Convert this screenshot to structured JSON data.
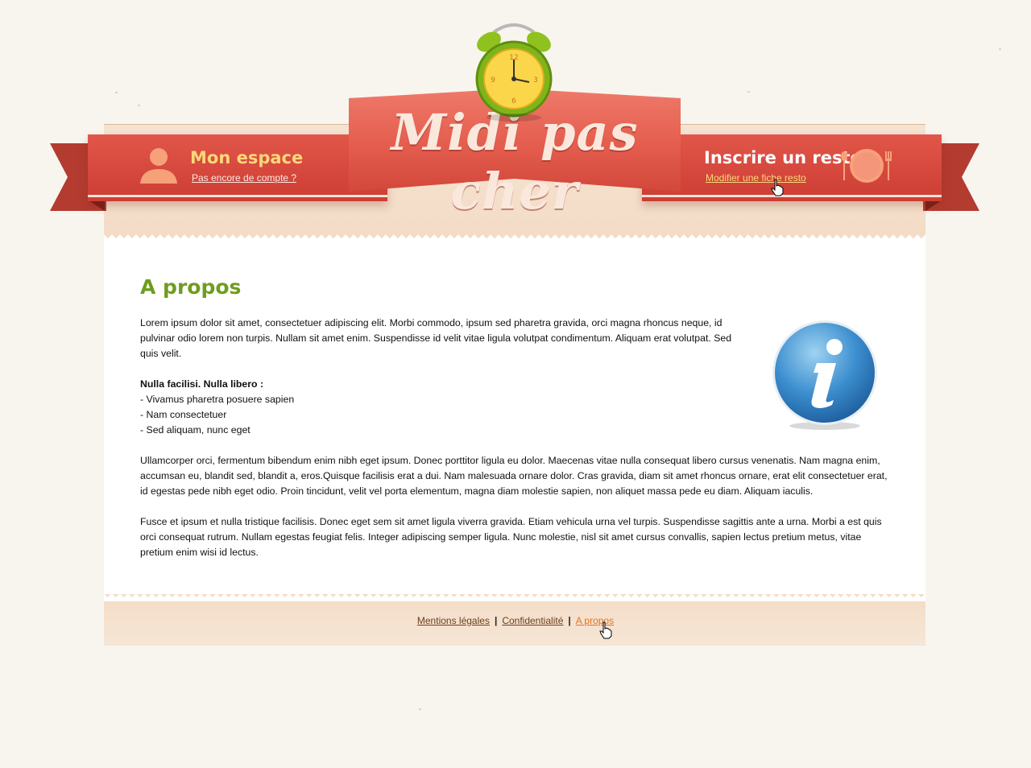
{
  "header": {
    "site_title": "Midi pas cher",
    "account": {
      "title": "Mon espace",
      "link": "Pas encore de compte ?"
    },
    "restaurant": {
      "title": "Inscrire un resto",
      "link": "Modifier une fiche resto"
    }
  },
  "main": {
    "title": "A propos",
    "intro": "Lorem ipsum dolor sit amet, consectetuer adipiscing elit. Morbi commodo, ipsum sed pharetra gravida, orci magna rhoncus neque, id pulvinar odio lorem non turpis. Nullam sit amet enim. Suspendisse id velit vitae ligula volutpat condimentum. Aliquam erat volutpat. Sed quis velit.",
    "list_title": "Nulla facilisi. Nulla libero :",
    "list_items": [
      "- Vivamus pharetra posuere sapien",
      "- Nam consectetuer",
      "- Sed aliquam, nunc eget"
    ],
    "paragraph2": "Ullamcorper orci, fermentum bibendum enim nibh eget ipsum. Donec porttitor ligula eu dolor. Maecenas vitae nulla consequat libero cursus venenatis. Nam magna enim, accumsan eu, blandit sed, blandit a, eros.Quisque facilisis erat a dui. Nam malesuada ornare dolor. Cras gravida, diam sit amet rhoncus ornare, erat elit consectetuer erat, id egestas pede nibh eget odio. Proin tincidunt, velit vel porta elementum, magna diam molestie sapien, non aliquet massa pede eu diam. Aliquam iaculis.",
    "paragraph3": "Fusce et ipsum et nulla tristique facilisis. Donec eget sem sit amet ligula viverra gravida. Etiam vehicula urna vel turpis. Suspendisse sagittis ante a urna. Morbi a est quis orci consequat rutrum. Nullam egestas feugiat felis. Integer adipiscing semper ligula. Nunc molestie, nisl sit amet cursus convallis, sapien lectus pretium metus, vitae pretium enim wisi id lectus."
  },
  "footer": {
    "links": [
      "Mentions légales",
      "Confidentialité",
      "A propos"
    ],
    "separator": "|",
    "active": "A propos"
  },
  "colors": {
    "ribbon_red": "#d9473c",
    "title_green": "#6e9d1e",
    "accent_yellow": "#fbd77a",
    "link_brown": "#6b3e1a",
    "active_orange": "#e8731b"
  },
  "icons": [
    "alarm-clock-icon",
    "user-icon",
    "plate-cutlery-icon",
    "info-icon",
    "hand-cursor-icon"
  ]
}
